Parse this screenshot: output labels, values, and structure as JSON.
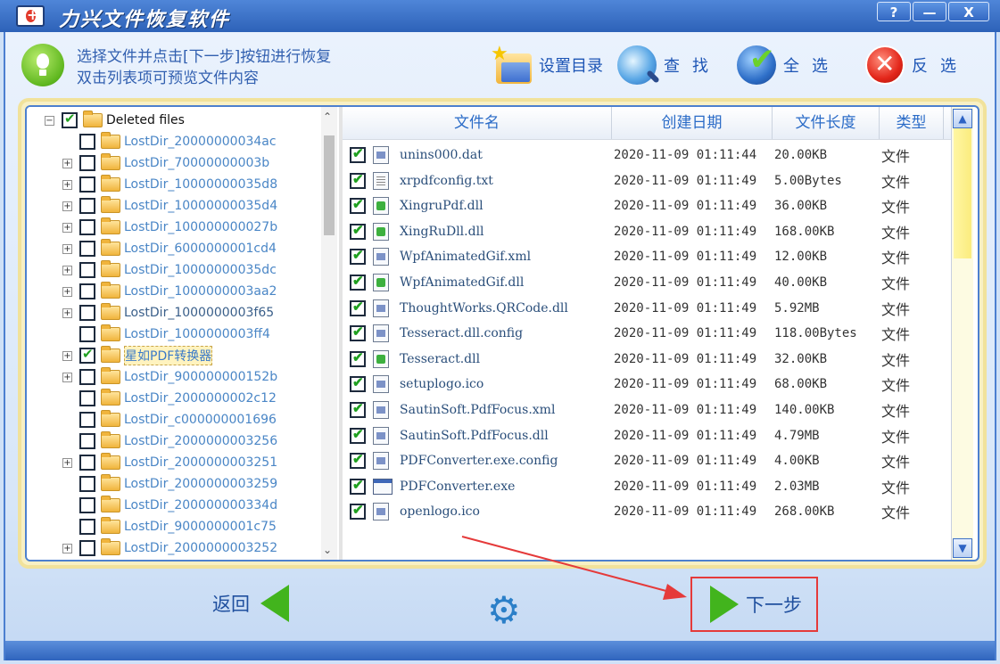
{
  "window": {
    "title": "力兴文件恢复软件",
    "buttons": {
      "help": "?",
      "minimize": "—",
      "close": "X"
    }
  },
  "hint": {
    "line1": "选择文件并点击[下一步]按钮进行恢复",
    "line2": "双击列表项可预览文件内容"
  },
  "toolbar": {
    "set_dir": "设置目录",
    "search": "查找",
    "select_all": "全选",
    "invert": "反选"
  },
  "tree": {
    "root_label": "Deleted files",
    "items": [
      {
        "label": "LostDir_20000000034ac",
        "expander": false,
        "checked": false
      },
      {
        "label": "LostDir_70000000003b",
        "expander": true,
        "checked": false
      },
      {
        "label": "LostDir_10000000035d8",
        "expander": true,
        "checked": false
      },
      {
        "label": "LostDir_10000000035d4",
        "expander": true,
        "checked": false
      },
      {
        "label": "LostDir_100000000027b",
        "expander": true,
        "checked": false
      },
      {
        "label": "LostDir_6000000001cd4",
        "expander": true,
        "checked": false
      },
      {
        "label": "LostDir_10000000035dc",
        "expander": true,
        "checked": false
      },
      {
        "label": "LostDir_1000000003aa2",
        "expander": true,
        "checked": false
      },
      {
        "label": "LostDir_1000000003f65",
        "expander": true,
        "checked": false
      },
      {
        "label": "LostDir_1000000003ff4",
        "expander": false,
        "checked": false
      },
      {
        "label": "星如PDF转换器",
        "expander": true,
        "checked": true
      },
      {
        "label": "LostDir_900000000152b",
        "expander": true,
        "checked": false
      },
      {
        "label": "LostDir_2000000002c12",
        "expander": false,
        "checked": false
      },
      {
        "label": "LostDir_c000000001696",
        "expander": false,
        "checked": false
      },
      {
        "label": "LostDir_2000000003256",
        "expander": false,
        "checked": false
      },
      {
        "label": "LostDir_2000000003251",
        "expander": true,
        "checked": false
      },
      {
        "label": "LostDir_2000000003259",
        "expander": false,
        "checked": false
      },
      {
        "label": "LostDir_200000000334d",
        "expander": false,
        "checked": false
      },
      {
        "label": "LostDir_9000000001c75",
        "expander": false,
        "checked": false
      },
      {
        "label": "LostDir_2000000003252",
        "expander": true,
        "checked": false
      }
    ]
  },
  "list": {
    "columns": [
      "文件名",
      "创建日期",
      "文件长度",
      "类型"
    ],
    "rows": [
      {
        "name": "unins000.dat",
        "date": "2020-11-09 01:11:44",
        "size": "20.00KB",
        "type": "文件",
        "icon": "generic"
      },
      {
        "name": "xrpdfconfig.txt",
        "date": "2020-11-09 01:11:49",
        "size": "5.00Bytes",
        "type": "文件",
        "icon": "txt"
      },
      {
        "name": "XingruPdf.dll",
        "date": "2020-11-09 01:11:49",
        "size": "36.00KB",
        "type": "文件",
        "icon": "dll"
      },
      {
        "name": "XingRuDll.dll",
        "date": "2020-11-09 01:11:49",
        "size": "168.00KB",
        "type": "文件",
        "icon": "dll"
      },
      {
        "name": "WpfAnimatedGif.xml",
        "date": "2020-11-09 01:11:49",
        "size": "12.00KB",
        "type": "文件",
        "icon": "generic"
      },
      {
        "name": "WpfAnimatedGif.dll",
        "date": "2020-11-09 01:11:49",
        "size": "40.00KB",
        "type": "文件",
        "icon": "dll"
      },
      {
        "name": "ThoughtWorks.QRCode.dll",
        "date": "2020-11-09 01:11:49",
        "size": "5.92MB",
        "type": "文件",
        "icon": "generic"
      },
      {
        "name": "Tesseract.dll.config",
        "date": "2020-11-09 01:11:49",
        "size": "118.00Bytes",
        "type": "文件",
        "icon": "generic"
      },
      {
        "name": "Tesseract.dll",
        "date": "2020-11-09 01:11:49",
        "size": "32.00KB",
        "type": "文件",
        "icon": "dll"
      },
      {
        "name": "setuplogo.ico",
        "date": "2020-11-09 01:11:49",
        "size": "68.00KB",
        "type": "文件",
        "icon": "generic"
      },
      {
        "name": "SautinSoft.PdfFocus.xml",
        "date": "2020-11-09 01:11:49",
        "size": "140.00KB",
        "type": "文件",
        "icon": "generic"
      },
      {
        "name": "SautinSoft.PdfFocus.dll",
        "date": "2020-11-09 01:11:49",
        "size": "4.79MB",
        "type": "文件",
        "icon": "generic"
      },
      {
        "name": "PDFConverter.exe.config",
        "date": "2020-11-09 01:11:49",
        "size": "4.00KB",
        "type": "文件",
        "icon": "generic"
      },
      {
        "name": "PDFConverter.exe",
        "date": "2020-11-09 01:11:49",
        "size": "2.03MB",
        "type": "文件",
        "icon": "exe"
      },
      {
        "name": "openlogo.ico",
        "date": "2020-11-09 01:11:49",
        "size": "268.00KB",
        "type": "文件",
        "icon": "generic"
      }
    ]
  },
  "bottom": {
    "back": "返回",
    "next": "下一步"
  },
  "colors": {
    "accent": "#2d62b8",
    "frame": "#f1e29b",
    "highlight": "#e53a3a"
  }
}
